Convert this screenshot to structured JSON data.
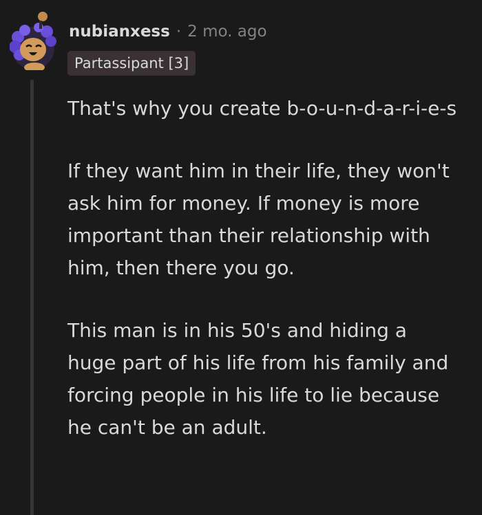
{
  "comment": {
    "username": "nubianxess",
    "separator": "·",
    "timestamp": "2 mo. ago",
    "flair": "Partassipant [3]",
    "paragraphs": [
      "That's why you create b-o-u-n-d-a-r-i-e-s",
      "If they want him in their life, they won't ask him for money. If money is more important than their relationship with him, then there you go.",
      "This man is in his 50's and hiding a huge part of his life from his family and forcing people in his life to lie because he can't be an adult."
    ]
  },
  "colors": {
    "background": "#1a1a1b",
    "text": "#d7dadc",
    "meta": "#818384",
    "flair_bg": "#3a3232",
    "thread_line": "#343536",
    "avatar_accent": "#6a4fd8"
  },
  "icons": {
    "avatar": "snoo-avatar-icon"
  }
}
